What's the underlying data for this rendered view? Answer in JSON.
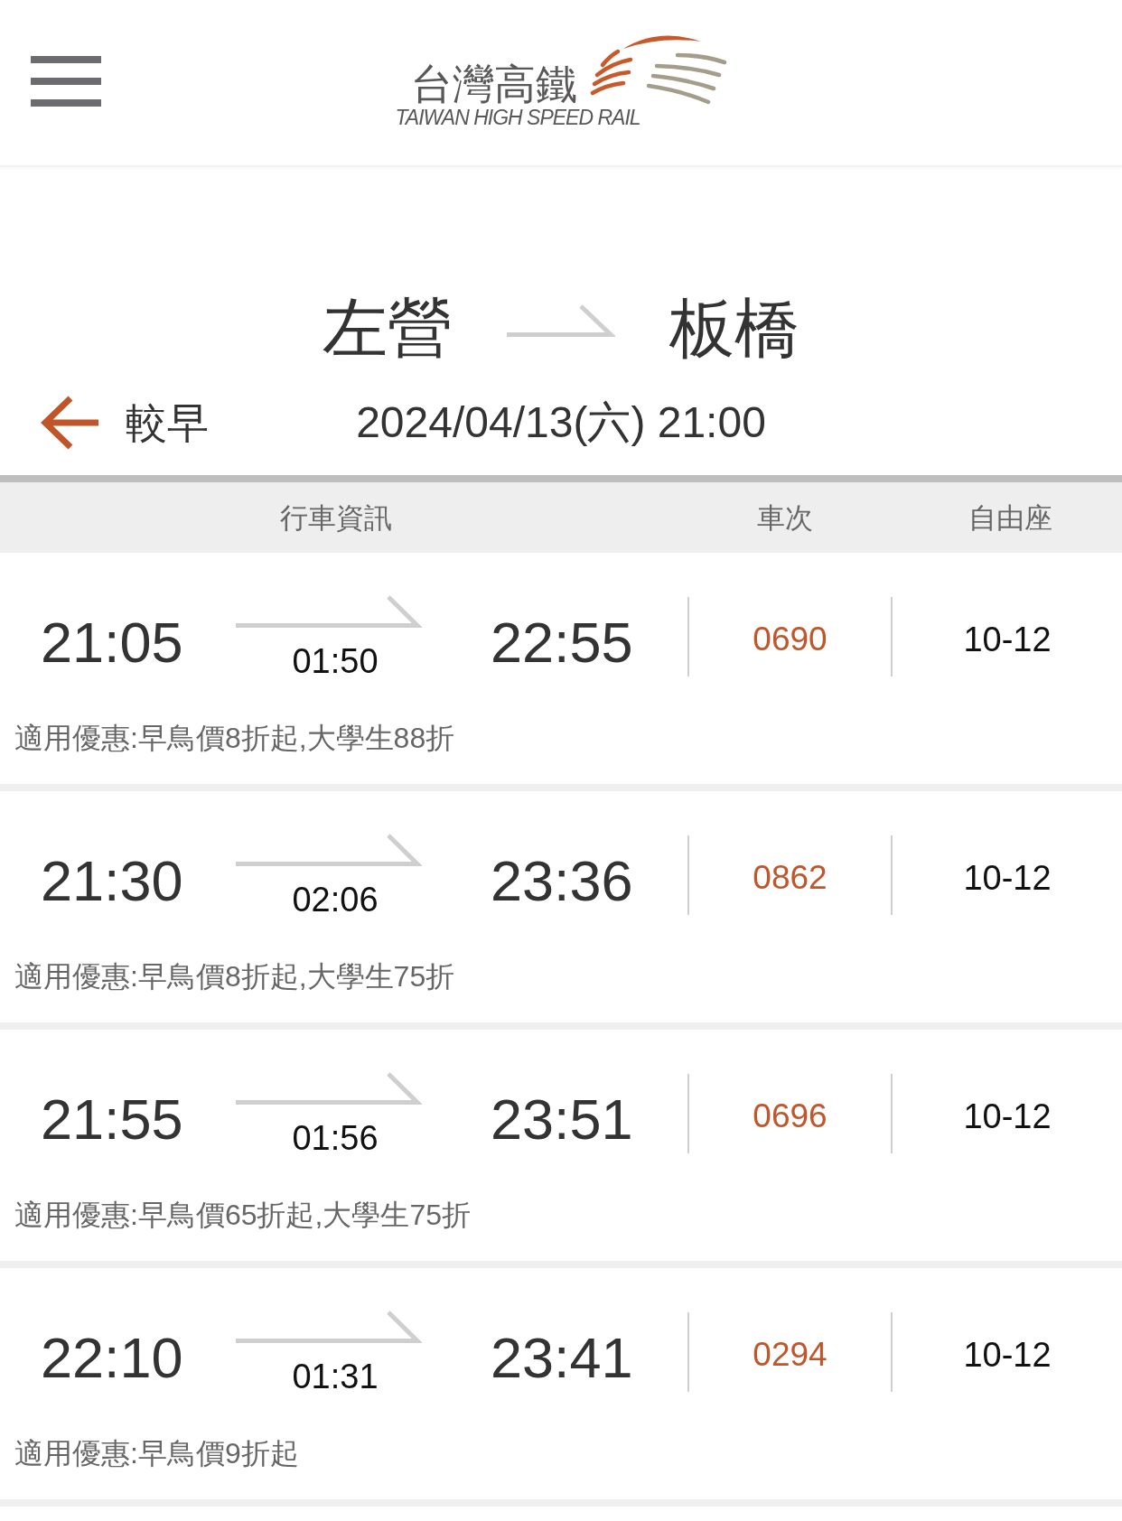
{
  "header": {
    "logo": {
      "title": "台灣高鐵",
      "subtitle": "TAIWAN HIGH SPEED RAIL"
    }
  },
  "route": {
    "origin": "左營",
    "destination": "板橋",
    "earlier_label": "較早",
    "date_time": "2024/04/13(六) 21:00"
  },
  "table": {
    "columns": [
      "行車資訊",
      "車次",
      "自由座"
    ],
    "rows": [
      {
        "departure": "21:05",
        "duration": "01:50",
        "arrival": "22:55",
        "train_number": "0690",
        "non_reserved_cars": "10-12",
        "discount": "適用優惠:早鳥價8折起,大學生88折"
      },
      {
        "departure": "21:30",
        "duration": "02:06",
        "arrival": "23:36",
        "train_number": "0862",
        "non_reserved_cars": "10-12",
        "discount": "適用優惠:早鳥價8折起,大學生75折"
      },
      {
        "departure": "21:55",
        "duration": "01:56",
        "arrival": "23:51",
        "train_number": "0696",
        "non_reserved_cars": "10-12",
        "discount": "適用優惠:早鳥價65折起,大學生75折"
      },
      {
        "departure": "22:10",
        "duration": "01:31",
        "arrival": "23:41",
        "train_number": "0294",
        "non_reserved_cars": "10-12",
        "discount": "適用優惠:早鳥價9折起"
      }
    ]
  }
}
